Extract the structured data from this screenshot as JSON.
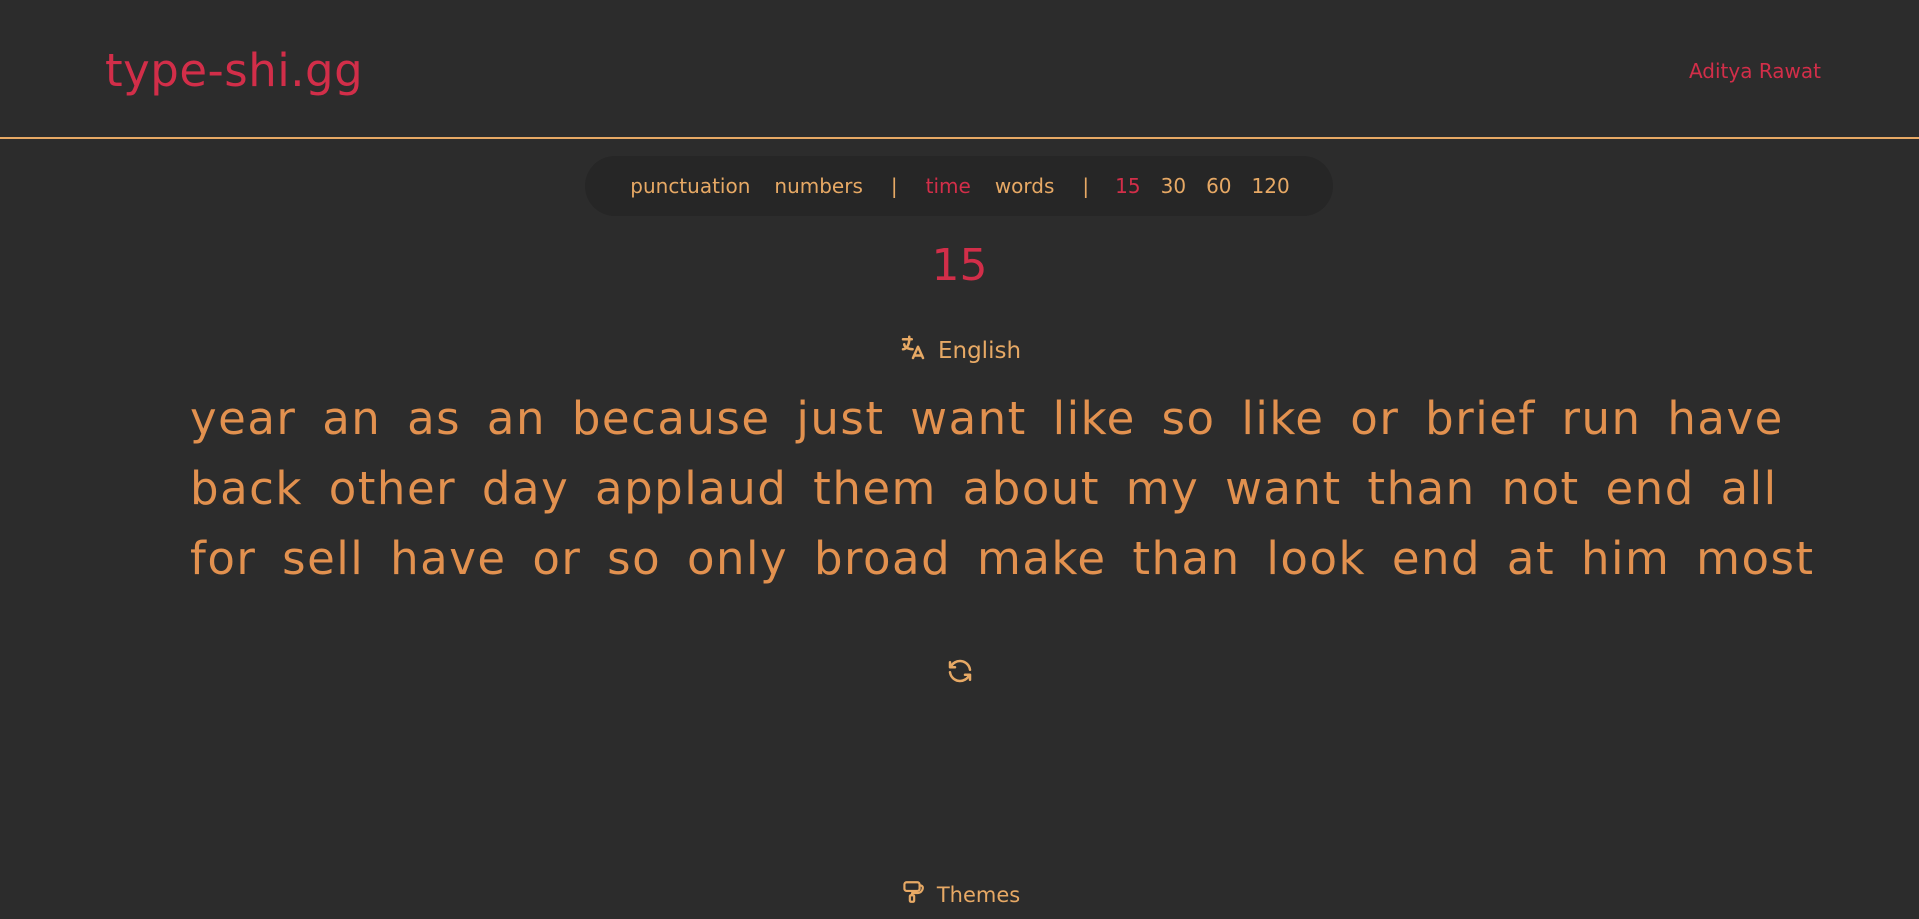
{
  "header": {
    "logo": "type-shi.gg",
    "user_name": "Aditya Rawat"
  },
  "toolbar": {
    "punctuation": "punctuation",
    "numbers": "numbers",
    "separator": "|",
    "mode_time": "time",
    "mode_words": "words",
    "durations": [
      "15",
      "30",
      "60",
      "120"
    ],
    "active_mode": "time",
    "active_duration": "15"
  },
  "timer": "15",
  "language": {
    "label": "English",
    "icon": "translate-icon"
  },
  "words": {
    "lines": [
      "year an as an because just want like so like or brief run have",
      "back other day applaud them about my want than not end all",
      "for sell have or so only broad make than look end at him most"
    ]
  },
  "restart": {
    "icon": "refresh-icon"
  },
  "footer": {
    "themes_label": "Themes",
    "themes_icon": "paint-brush-icon"
  },
  "colors": {
    "background": "#2c2c2c",
    "accent": "#d22e49",
    "text": "#e2914f",
    "toolbar_bg": "#262626",
    "divider": "#e7a965"
  }
}
